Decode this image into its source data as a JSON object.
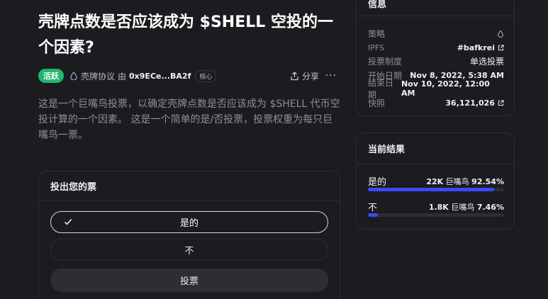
{
  "proposal": {
    "title": "壳牌点数是否应该成为 $SHELL 空投的一个因素?",
    "status": "活跃",
    "space_name": "壳牌协议",
    "by": "由",
    "author": "0x9ECe...BA2f",
    "author_role": "核心",
    "share_label": "分享",
    "more_label": "···",
    "description": "这是一个巨嘴鸟投票，以确定壳牌点数是否应该成为 $SHELL 代币空投计算的一个因素。 这是一个简单的是/否投票，投票权重为每只巨嘴鸟一票。"
  },
  "vote": {
    "heading": "投出您的票",
    "options": [
      "是的",
      "不"
    ],
    "selected": 0,
    "submit_label": "投票"
  },
  "info": {
    "heading": "信息",
    "rows": [
      {
        "key": "策略",
        "value": ""
      },
      {
        "key": "IPFS",
        "value": "#bafkrei"
      },
      {
        "key": "投票制度",
        "value": "单选投票"
      },
      {
        "key": "开始日期",
        "value": "Nov 8, 2022, 5:38 AM"
      },
      {
        "key": "结束日期",
        "value": "Nov 10, 2022, 12:00 AM"
      },
      {
        "key": "快照",
        "value": "36,121,026"
      }
    ]
  },
  "results": {
    "heading": "当前结果",
    "items": [
      {
        "label": "是的",
        "amount": "22K",
        "unit": "巨嘴鸟",
        "percent": "92.54%",
        "fraction": 0.9254
      },
      {
        "label": "不",
        "amount": "1.8K",
        "unit": "巨嘴鸟",
        "percent": "7.46%",
        "fraction": 0.0746
      }
    ]
  },
  "colors": {
    "accent": "#384aff",
    "active_badge": "#21b66f",
    "background": "#1c1b1f",
    "border": "#2e2d32"
  },
  "icons": {
    "space": "droplet-icon",
    "share": "share-icon",
    "check": "check-icon",
    "external": "external-link-icon",
    "strategy": "droplet-icon"
  }
}
